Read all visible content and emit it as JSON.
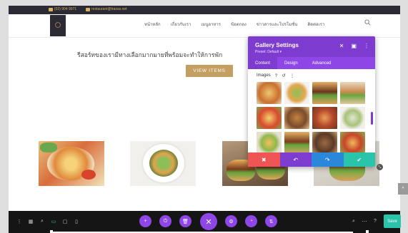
{
  "topbar": {
    "phone": "(02) 904 9971",
    "email": "restaurant@trazas.net"
  },
  "nav": {
    "items": [
      {
        "label": "หน้าหลัก"
      },
      {
        "label": "เกี่ยวกับเรา"
      },
      {
        "label": "เมนูอาหาร"
      },
      {
        "label": "ข้อตกลง"
      },
      {
        "label": "ข่าวสารและโปรโมชั่น"
      },
      {
        "label": "ติดต่อเรา"
      }
    ]
  },
  "hero": {
    "heading": "รีสอร์ทของเรามีทางเลือกมากมายที่พร้อมจะทำให้การพัก",
    "button_label": "VIEW ITEMS"
  },
  "modal": {
    "title": "Gallery Settings",
    "preset": "Preset: Default ▾",
    "header_icons": [
      "✕",
      "▣",
      "⋮"
    ],
    "tabs": [
      {
        "label": "Content"
      },
      {
        "label": "Design"
      },
      {
        "label": "Advanced"
      }
    ],
    "images_label": "Images",
    "image_tools": [
      "?",
      "↺",
      "⋮"
    ],
    "footer_icons": [
      "✖",
      "↶",
      "↷",
      "✔"
    ]
  },
  "builder": {
    "left_icons": [
      "⋮",
      "▦",
      "⌕",
      "▭",
      "▢",
      "▯"
    ],
    "center_icons": [
      "+",
      "⏻",
      "🗑",
      "✕",
      "⚙",
      "◔",
      "⇅"
    ],
    "right_icons": [
      "⌕",
      "⋯",
      "?"
    ],
    "save_label": "Save"
  },
  "colors": {
    "accent": "#7e3bd0",
    "gold": "#c3a062",
    "save": "#29c4a9",
    "cancel": "#ef5555",
    "redo": "#2b87da"
  }
}
